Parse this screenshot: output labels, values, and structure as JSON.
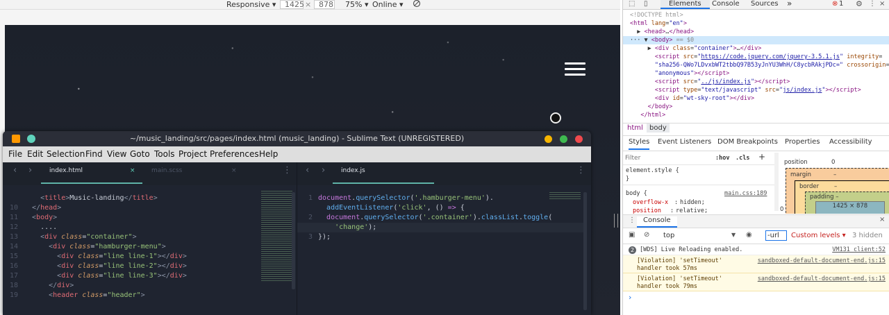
{
  "toolbar": {
    "device": "Responsive",
    "width": "1425",
    "times": "×",
    "height": "878",
    "zoom": "75%",
    "throttle": "Online"
  },
  "sublime": {
    "title": "~/music_landing/src/pages/index.html (music_landing) - Sublime Text (UNREGISTERED)",
    "menu": [
      "File",
      "Edit",
      "Selection",
      "Find",
      "View",
      "Goto",
      "Tools",
      "Project",
      "Preferences",
      "Help"
    ],
    "tabs_left": [
      {
        "label": "index.html",
        "close": "×"
      },
      {
        "label": "main.scss",
        "close": "×"
      }
    ],
    "tabs_right": [
      {
        "label": "index.js"
      }
    ],
    "left_lines": [
      {
        "n": "",
        "html": "    <span class=\"p\">&lt;</span><span class=\"k\">title</span><span class=\"p\">&gt;</span>Music-landing<span class=\"p\">&lt;/</span><span class=\"k\">title</span><span class=\"p\">&gt;</span>"
      },
      {
        "n": "10",
        "html": "  <span class=\"p\">&lt;/</span><span class=\"k\">head</span><span class=\"p\">&gt;</span>"
      },
      {
        "n": "11",
        "html": "  <span class=\"p\">&lt;</span><span class=\"k\">body</span><span class=\"p\">&gt;</span>"
      },
      {
        "n": "12",
        "html": "    ...."
      },
      {
        "n": "13",
        "html": "    <span class=\"p\">&lt;</span><span class=\"k\">div</span> <span class=\"a\">class</span>=<span class=\"s\">\"container\"</span><span class=\"p\">&gt;</span>"
      },
      {
        "n": "14",
        "html": "      <span class=\"p\">&lt;</span><span class=\"k\">div</span> <span class=\"a\">class</span>=<span class=\"s\">\"hamburger-menu\"</span><span class=\"p\">&gt;</span>"
      },
      {
        "n": "15",
        "html": "        <span class=\"p\">&lt;</span><span class=\"k\">div</span> <span class=\"a\">class</span>=<span class=\"s\">\"line line-1\"</span><span class=\"p\">&gt;&lt;/</span><span class=\"k\">div</span><span class=\"p\">&gt;</span>"
      },
      {
        "n": "16",
        "html": "        <span class=\"p\">&lt;</span><span class=\"k\">div</span> <span class=\"a\">class</span>=<span class=\"s\">\"line line-2\"</span><span class=\"p\">&gt;&lt;/</span><span class=\"k\">div</span><span class=\"p\">&gt;</span>"
      },
      {
        "n": "17",
        "html": "        <span class=\"p\">&lt;</span><span class=\"k\">div</span> <span class=\"a\">class</span>=<span class=\"s\">\"line line-3\"</span><span class=\"p\">&gt;&lt;/</span><span class=\"k\">div</span><span class=\"p\">&gt;</span>"
      },
      {
        "n": "18",
        "html": "      <span class=\"p\">&lt;/</span><span class=\"k\">div</span><span class=\"p\">&gt;</span>"
      },
      {
        "n": "19",
        "html": "      <span class=\"p\">&lt;</span><span class=\"k\">header</span> <span class=\"a\">class</span>=<span class=\"s\">\"header\"</span><span class=\"p\">&gt;</span>"
      }
    ],
    "right_lines": [
      {
        "n": "1",
        "html": "<span class=\"v\">document</span>.<span class=\"f\">querySelector</span>(<span class=\"s\">'.hamburger-menu'</span>)."
      },
      {
        "n": "",
        "html": "  <span class=\"f\">addEventListener</span>(<span class=\"s\">'click'</span>, () <span class=\"o\">=&gt;</span> {"
      },
      {
        "n": "2",
        "html": "  <span class=\"v\">document</span>.<span class=\"f\">querySelector</span>(<span class=\"s\">'.container'</span>).<span class=\"f\">classList</span>.<span class=\"f\">toggle</span>("
      },
      {
        "n": "",
        "html": "    <span class=\"s\">'change'</span>);"
      },
      {
        "n": "3",
        "html": "});"
      }
    ]
  },
  "devtools": {
    "tabs": [
      "Elements",
      "Console",
      "Sources",
      "»"
    ],
    "error_count": "1",
    "dom": [
      {
        "html": "<span style=\"color:#999\">&lt;!DOCTYPE html&gt;</span>"
      },
      {
        "html": "<span class=\"tg\">&lt;html</span> <span class=\"an\">lang</span>=<span class=\"av\">\"en\"</span><span class=\"tg\">&gt;</span>"
      },
      {
        "html": "  ▶ <span class=\"tg\">&lt;head&gt;</span>…<span class=\"tg\">&lt;/head&gt;</span>"
      },
      {
        "html": "··· ▼ <span class=\"tg\">&lt;body&gt;</span> <span style=\"color:#888\">== $0</span>",
        "sel": true
      },
      {
        "html": "     ▶ <span class=\"tg\">&lt;div</span> <span class=\"an\">class</span>=<span class=\"av\">\"container\"</span><span class=\"tg\">&gt;</span>…<span class=\"tg\">&lt;/div&gt;</span>"
      },
      {
        "html": "       <span class=\"tg\">&lt;script</span> <span class=\"an\">src</span>=<span class=\"av\">\"<span class=\"lnk\">https://code.jquery.com/jquery-3.5.1.js</span>\"</span> <span class=\"an\">integrity</span>="
      },
      {
        "html": "       <span class=\"av\">\"sha256-QWo7LDvxbWT2tbbQ97B53yJnYU3WhH/C8ycbRAkjPDc=\"</span> <span class=\"an\">crossorigin</span>="
      },
      {
        "html": "       <span class=\"av\">\"anonymous\"</span><span class=\"tg\">&gt;&lt;/script&gt;</span>"
      },
      {
        "html": "       <span class=\"tg\">&lt;script</span> <span class=\"an\">src</span>=<span class=\"av\">\"<span class=\"lnk\">../js/index.js</span>\"</span><span class=\"tg\">&gt;&lt;/script&gt;</span>"
      },
      {
        "html": "       <span class=\"tg\">&lt;script</span> <span class=\"an\">type</span>=<span class=\"av\">\"text/javascript\"</span> <span class=\"an\">src</span>=<span class=\"av\">\"<span class=\"lnk\">js/index.js</span>\"</span><span class=\"tg\">&gt;&lt;/script&gt;</span>"
      },
      {
        "html": "       <span class=\"tg\">&lt;div</span> <span class=\"an\">id</span>=<span class=\"av\">\"wt-sky-root\"</span><span class=\"tg\">&gt;&lt;/div&gt;</span>"
      },
      {
        "html": "     <span class=\"tg\">&lt;/body&gt;</span>"
      },
      {
        "html": "   <span class=\"tg\">&lt;/html&gt;</span>"
      }
    ],
    "breadcrumb": [
      "html",
      "body"
    ],
    "style_tabs": [
      "Styles",
      "Event Listeners",
      "DOM Breakpoints",
      "Properties",
      "Accessibility"
    ],
    "filter_placeholder": "Filter",
    "hov": ":hov",
    "cls": ".cls",
    "plus": "+",
    "element_style": "element.style {",
    "close_brace": "}",
    "body_rule": "body {",
    "body_src": "main.css:189",
    "rule1_prop": "overflow-x",
    "rule1_val": "hidden;",
    "rule2_prop": "position",
    "rule2_val": "relative;",
    "box": {
      "position_label": "position",
      "position_val": "0",
      "margin_label": "margin",
      "margin_val": "–",
      "border_label": "border",
      "border_val": "–",
      "padding_label": "padding –",
      "content": "1425 × 878",
      "side": "–",
      "zero": "0"
    },
    "console": {
      "title": "Console",
      "close": "×",
      "context": "top",
      "filter": "-url",
      "levels": "Custom levels ▾",
      "hidden": "3 hidden",
      "messages": [
        {
          "badge": "2",
          "text": "[WDS] Live Reloading enabled.",
          "src": "VM131 client:52",
          "warn": false
        },
        {
          "text": "[Violation] 'setTimeout'",
          "text2": "handler took 57ms",
          "src": "sandboxed-default-document-end.js:15",
          "warn": true
        },
        {
          "text": "[Violation] 'setTimeout'",
          "text2": "handler took 79ms",
          "src": "sandboxed-default-document-end.js:15",
          "warn": true
        }
      ],
      "prompt": "›"
    }
  }
}
